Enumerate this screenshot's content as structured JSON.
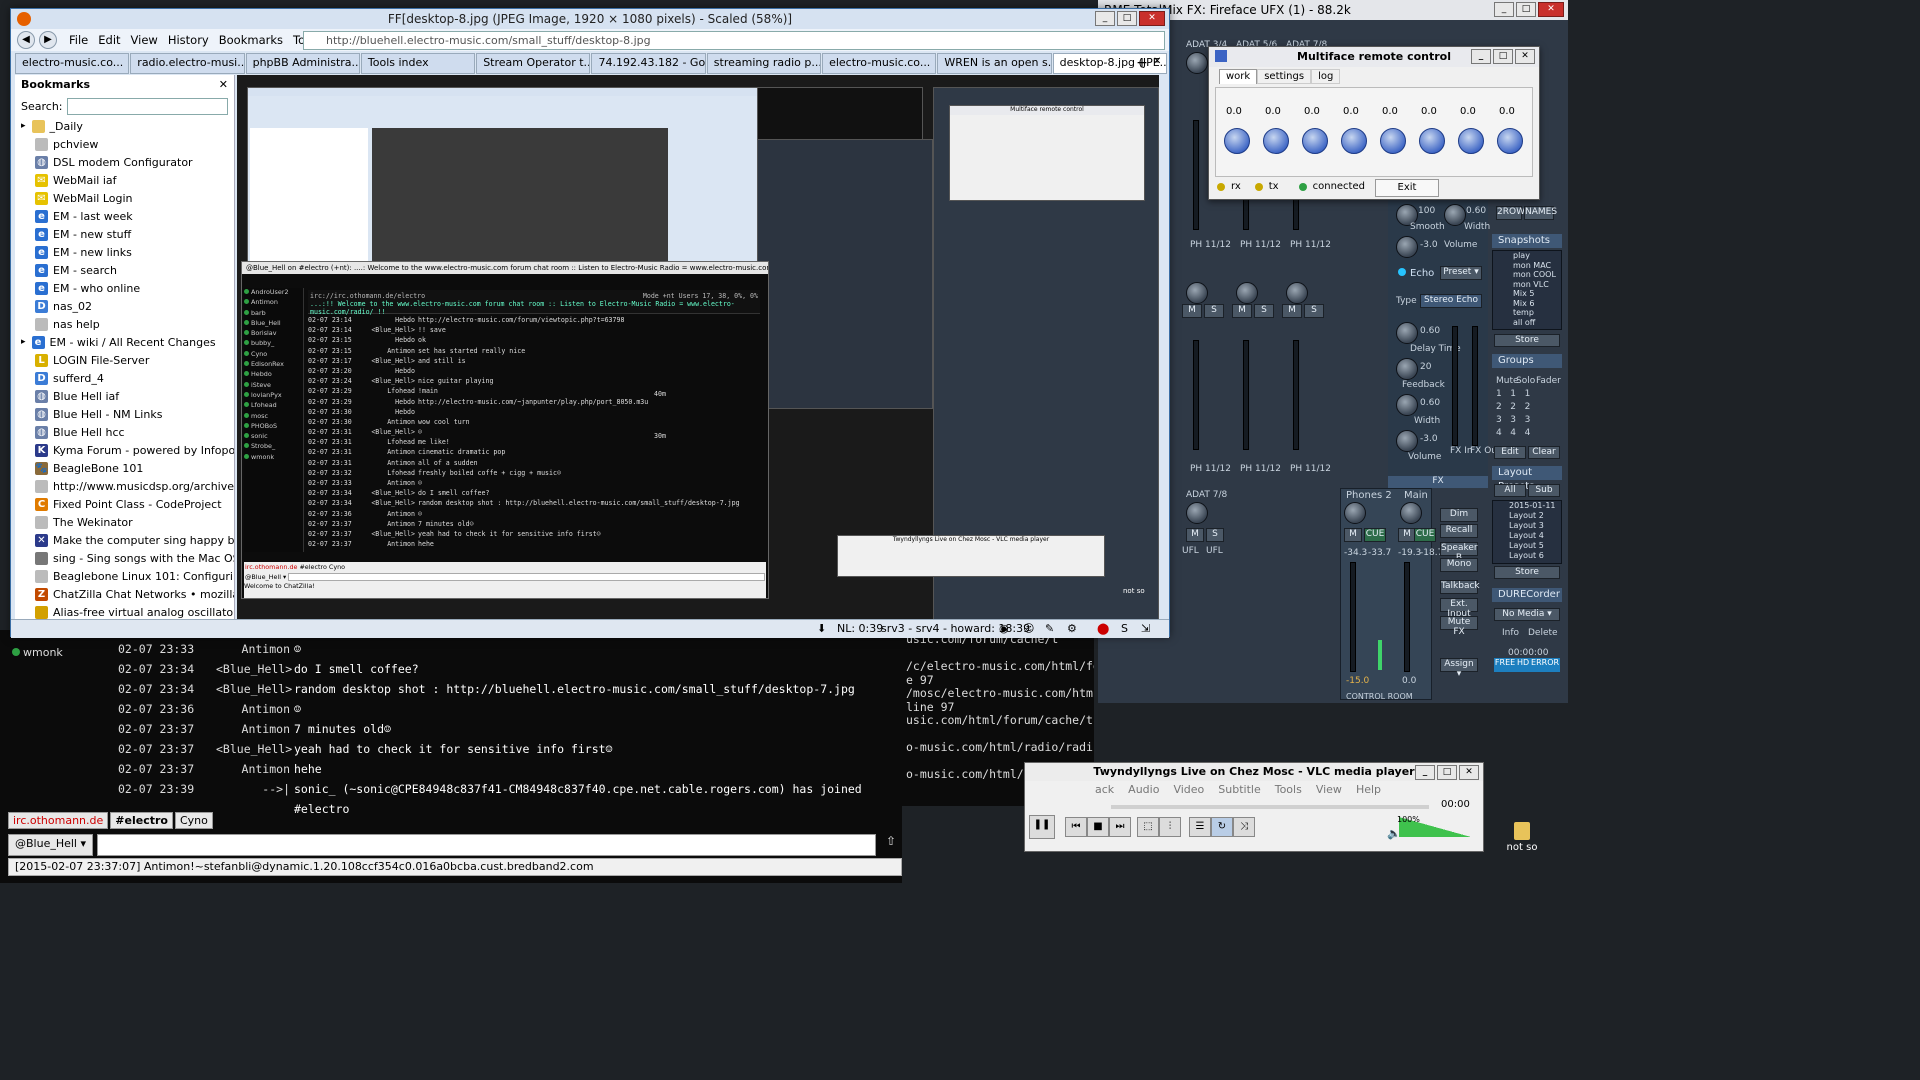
{
  "chat_bg": {
    "nick": "wmonk",
    "lines": [
      {
        "time": "02-07 23:33",
        "nick": "Antimon",
        "msg": "☺"
      },
      {
        "time": "02-07 23:34",
        "nick": "<Blue_Hell>",
        "msg": "do I smell coffee?"
      },
      {
        "time": "02-07 23:34",
        "nick": "<Blue_Hell>",
        "msg": "random desktop shot : http://bluehell.electro-music.com/small_stuff/desktop-7.jpg"
      },
      {
        "time": "02-07 23:36",
        "nick": "Antimon",
        "msg": "☺"
      },
      {
        "time": "02-07 23:37",
        "nick": "Antimon",
        "msg": "7 minutes old☺"
      },
      {
        "time": "02-07 23:37",
        "nick": "<Blue_Hell>",
        "msg": "yeah had to check it for sensitive info first☺"
      },
      {
        "time": "02-07 23:37",
        "nick": "Antimon",
        "msg": "hehe"
      },
      {
        "time": "02-07 23:39",
        "nick": "-->|",
        "msg": "sonic_ (~sonic@CPE84948c837f41-CM84948c837f40.cpe.net.cable.rogers.com) has joined"
      },
      {
        "time": "",
        "nick": "",
        "msg": "#electro"
      }
    ],
    "tabs": [
      "irc.othomann.de",
      "#electro",
      "Cyno"
    ],
    "nick_button": "@Blue_Hell ▾",
    "status": "[2015-02-07 23:37:07] Antimon!~stefanbli@dynamic.1.20.108ccf354c0.016a0bcba.cust.bredband2.com"
  },
  "terminal_bg": {
    "lines": [
      "usic.com/forum/cache/t",
      "",
      "/c/electro-music.com/html/fo",
      "e 97",
      "/mosc/electro-music.com/htm",
      " line 97",
      "usic.com/html/forum/cache/t",
      "",
      "o-music.com/html/radio/radi",
      "",
      "o-music.com/html/radio/radi"
    ]
  },
  "mixer": {
    "title": "RME TotalMix FX: Fireface UFX (1) - 88.2k",
    "adat_labels": [
      "ADAT 3/4",
      "ADAT 5/6",
      "ADAT 7/8"
    ],
    "adat_78": "ADAT 7/8",
    "phones2": "Phones 2",
    "main": "Main",
    "ph_labels": [
      "PH 11/12",
      "PH 11/12",
      "PH 11/12"
    ],
    "ufl": "UFL",
    "levels": [
      "-34.3",
      "-33.7",
      "-19.3",
      "-18.7"
    ],
    "bottom_levels": [
      "-15.0",
      "0.0"
    ],
    "control_room": "CONTROL ROOM",
    "fx": "FX",
    "echo": "Echo",
    "preset": "Preset ▾",
    "type": "Type",
    "stereo_echo": "Stereo Echo",
    "smooth": "Smooth",
    "volume": "Volume",
    "delay_time": "Delay Time",
    "feedback": "Feedback",
    "width": "Width",
    "fx_in": "FX In",
    "fx_out": "FX Out",
    "vals": {
      "v100": "100",
      "v060": "0.60",
      "vm30": "-3.0",
      "v020": "20"
    },
    "snapshots_hdr": "Snapshots",
    "snapshots": [
      "play",
      "mon MAC",
      "mon COOL",
      "mon VLC",
      "Mix 5",
      "Mix 6",
      "temp",
      "all off"
    ],
    "store": "Store",
    "groups_hdr": "Groups",
    "groups_cols": [
      "Mute",
      "Solo",
      "Fader"
    ],
    "edit": "Edit",
    "clear": "Clear",
    "layout_hdr": "Layout Presets",
    "layout_tabs": [
      "All",
      "Sub"
    ],
    "layouts": [
      "2015-01-11",
      "Layout 2",
      "Layout 3",
      "Layout 4",
      "Layout 5",
      "Layout 6"
    ],
    "durec_hdr": "DURECorder",
    "no_media": "No Media ▾",
    "info": "Info",
    "delete": "Delete",
    "time": "00:00:00",
    "free": "FREE",
    "hd": "HD",
    "error": "ERROR",
    "right_btns": [
      "Dim",
      "Recall",
      "Speaker B",
      "Mono",
      "Talkback",
      "Ext. Input",
      "Mute FX",
      "Assign ▾"
    ],
    "top_btns": [
      "2ROW",
      "NAMES"
    ],
    "accent": "#3f5876"
  },
  "remote": {
    "title": "Multiface remote control",
    "tabs": [
      "work",
      "settings",
      "log"
    ],
    "values": [
      "0.0",
      "0.0",
      "0.0",
      "0.0",
      "0.0",
      "0.0",
      "0.0",
      "0.0"
    ],
    "rx": "rx",
    "tx": "tx",
    "connected": "connected",
    "exit": "Exit"
  },
  "vlc": {
    "title": "Twyndyllyngs Live on Chez Mosc - VLC media player",
    "menu": [
      "ack",
      "Audio",
      "Video",
      "Subtitle",
      "Tools",
      "View",
      "Help"
    ],
    "time": "00:00",
    "volume": "100%"
  },
  "desktop_icon": {
    "label": "not so"
  },
  "firefox": {
    "title": "FF[desktop-8.jpg (JPEG Image, 1920 × 1080 pixels) - Scaled (58%)]",
    "menu": [
      "File",
      "Edit",
      "View",
      "History",
      "Bookmarks",
      "Tools",
      "Help"
    ],
    "url": "http://bluehell.electro-music.com/small_stuff/desktop-8.jpg",
    "tabs": [
      "electro-music.co...",
      "radio.electro-musi...",
      "phpBB Administra...",
      "Tools index",
      "Stream Operator t...",
      "74.192.43.182 - Go...",
      "streaming radio p...",
      "electro-music.co...",
      "WREN is an open s...",
      "desktop-8.jpg (JPE..."
    ],
    "new_tab": "+",
    "sidebar_title": "Bookmarks",
    "search_label": "Search:",
    "bookmarks": [
      {
        "label": "_Daily",
        "icon": "folder-icon",
        "color": "#e8c35a",
        "indent": 0
      },
      {
        "label": "pchview",
        "icon": "page-icon",
        "color": "#bbbbbb",
        "indent": 1
      },
      {
        "label": "DSL modem Configurator",
        "icon": "globe-icon",
        "color": "#6a7fa8",
        "indent": 1
      },
      {
        "label": "WebMail iaf",
        "icon": "webmail-icon",
        "color": "#e6c200",
        "indent": 1
      },
      {
        "label": "WebMail Login",
        "icon": "webmail-icon",
        "color": "#e6c200",
        "indent": 1
      },
      {
        "label": "EM - last week",
        "icon": "e-icon",
        "color": "#2a6fd1",
        "indent": 1
      },
      {
        "label": "EM - new stuff",
        "icon": "e-icon",
        "color": "#2a6fd1",
        "indent": 1
      },
      {
        "label": "EM - new links",
        "icon": "e-icon",
        "color": "#2a6fd1",
        "indent": 1
      },
      {
        "label": "EM - search",
        "icon": "e-icon",
        "color": "#2a6fd1",
        "indent": 1
      },
      {
        "label": "EM - who online",
        "icon": "e-icon",
        "color": "#2a6fd1",
        "indent": 1
      },
      {
        "label": "nas_02",
        "icon": "dsm-icon",
        "color": "#3b7cd6",
        "indent": 1
      },
      {
        "label": "nas help",
        "icon": "page-icon",
        "color": "#bbbbbb",
        "indent": 1
      },
      {
        "label": "EM - wiki / All Recent Changes",
        "icon": "e-icon",
        "color": "#2a6fd1",
        "indent": 0
      },
      {
        "label": "LOGIN File-Server",
        "icon": "login-icon",
        "color": "#d8b000",
        "indent": 1
      },
      {
        "label": "sufferd_4",
        "icon": "dsm-icon",
        "color": "#3b7cd6",
        "indent": 1
      },
      {
        "label": "Blue Hell iaf",
        "icon": "globe-icon",
        "color": "#6a7fa8",
        "indent": 1
      },
      {
        "label": "Blue Hell - NM Links",
        "icon": "globe-icon",
        "color": "#6a7fa8",
        "indent": 1
      },
      {
        "label": "Blue Hell hcc",
        "icon": "globe-icon",
        "color": "#6a7fa8",
        "indent": 1
      },
      {
        "label": "Kyma Forum - powered by Infopop",
        "icon": "kyma-icon",
        "color": "#2b3a8a",
        "indent": 1
      },
      {
        "label": "BeagleBone 101",
        "icon": "dog-icon",
        "color": "#8a6a3a",
        "indent": 1
      },
      {
        "label": "http://www.musicdsp.org/archive.p...",
        "icon": "page-icon",
        "color": "#bbbbbb",
        "indent": 1
      },
      {
        "label": "Fixed Point Class - CodeProject",
        "icon": "codeproject-icon",
        "color": "#e07b00",
        "indent": 1
      },
      {
        "label": "The Wekinator",
        "icon": "page-icon",
        "color": "#bbbbbb",
        "indent": 1
      },
      {
        "label": "Make the computer sing happy birt...",
        "icon": "x-icon",
        "color": "#2b3a8a",
        "indent": 1
      },
      {
        "label": "sing - Sing songs with the Mac OS X...",
        "icon": "apple-icon",
        "color": "#777777",
        "indent": 1
      },
      {
        "label": "Beaglebone Linux 101: Configuring ...",
        "icon": "page-icon",
        "color": "#bbbbbb",
        "indent": 1
      },
      {
        "label": "ChatZilla Chat Networks • mozillaZi...",
        "icon": "chatzilla-icon",
        "color": "#c24a00",
        "indent": 1
      },
      {
        "label": "Alias-free virtual analog oscillators ...",
        "icon": "page-icon",
        "color": "#d2a000",
        "indent": 1
      }
    ],
    "status": {
      "nl": "NL: 0:39",
      "servers": "srv3 - srv4 - howard: 18:39"
    }
  },
  "nested": {
    "chat_title": "@Blue_Hell on #electro (+nt): ....: Welcome to the www.electro-music.com forum chat room :: Listen to Electro-Music Radio = www.electro-music.com/radio/ :",
    "url": "irc://irc.othomann.de/electro",
    "mode": "Mode +nt   Users 17, 38, 0%, 0%",
    "topic": "...:!! Welcome to the www.electro-music.com forum chat room :: Listen to Electro-Music Radio = www.electro-music.com/radio/ !!",
    "users": [
      "AndroUser2",
      "Antimon",
      "barb",
      "Blue_Hell",
      "Borislav",
      "bubby_",
      "Cyno",
      "EdisonRex",
      "Hebdo",
      "iSteve",
      "lovianPyx",
      "Lfohead",
      "mosc",
      "PHOBoS",
      "sonic",
      "Strobe_",
      "wmonk"
    ],
    "lines": [
      {
        "time": "02-07 23:14",
        "nick": "Hebdo",
        "msg": "http://electro-music.com/forum/viewtopic.php?t=63798"
      },
      {
        "time": "02-07 23:14",
        "nick": "<Blue_Hell>",
        "msg": "!! save"
      },
      {
        "time": "02-07 23:15",
        "nick": "Hebdo",
        "msg": "ok"
      },
      {
        "time": "02-07 23:15",
        "nick": "Antimon",
        "msg": "set has started really nice"
      },
      {
        "time": "02-07 23:17",
        "nick": "<Blue_Hell>",
        "msg": "and still is"
      },
      {
        "time": "02-07 23:20",
        "nick": "Hebdo",
        "msg": ""
      },
      {
        "time": "02-07 23:24",
        "nick": "<Blue_Hell>",
        "msg": "nice guitar playing"
      },
      {
        "time": "02-07 23:29",
        "nick": "Lfohead",
        "msg": "!main"
      },
      {
        "time": "02-07 23:29",
        "nick": "Hebdo",
        "msg": "http://electro-music.com/~janpunter/play.php/port_8050.m3u"
      },
      {
        "time": "02-07 23:30",
        "nick": "Hebdo",
        "msg": ""
      },
      {
        "time": "02-07 23:30",
        "nick": "Antimon",
        "msg": "wow cool turn"
      },
      {
        "time": "02-07 23:31",
        "nick": "<Blue_Hell>",
        "msg": "☺"
      },
      {
        "time": "02-07 23:31",
        "nick": "Lfohead",
        "msg": "me like!"
      },
      {
        "time": "02-07 23:31",
        "nick": "Antimon",
        "msg": "cinematic dramatic pop"
      },
      {
        "time": "02-07 23:31",
        "nick": "Antimon",
        "msg": "all of a sudden"
      },
      {
        "time": "02-07 23:32",
        "nick": "Lfohead",
        "msg": "freshly boiled coffe + cigg + music☺"
      },
      {
        "time": "02-07 23:33",
        "nick": "Antimon",
        "msg": "☺"
      },
      {
        "time": "02-07 23:34",
        "nick": "<Blue_Hell>",
        "msg": "do I smell coffee?"
      },
      {
        "time": "02-07 23:34",
        "nick": "<Blue_Hell>",
        "msg": "random desktop shot : http://bluehell.electro-music.com/small_stuff/desktop-7.jpg"
      },
      {
        "time": "02-07 23:36",
        "nick": "Antimon",
        "msg": "☺"
      },
      {
        "time": "02-07 23:37",
        "nick": "Antimon",
        "msg": "7 minutes old☺"
      },
      {
        "time": "02-07 23:37",
        "nick": "<Blue_Hell>",
        "msg": "yeah had to check it for sensitive info first☺"
      },
      {
        "time": "02-07 23:37",
        "nick": "Antimon",
        "msg": "hehe"
      }
    ],
    "side_times": [
      "40m",
      "30m"
    ],
    "tabs": [
      "irc.othomann.de",
      "#electro",
      "Cyno"
    ],
    "nick_button": "@Blue_Hell ▾",
    "welcome": "Welcome to ChatZilla!",
    "vlc_title": "Twyndyllyngs Live on Chez Mosc - VLC media player",
    "remote_title": "Multiface remote control",
    "mixer_title": "RME TotalMix FX: Fireface UFX (1) - 88.2k",
    "not_so": "not so"
  }
}
